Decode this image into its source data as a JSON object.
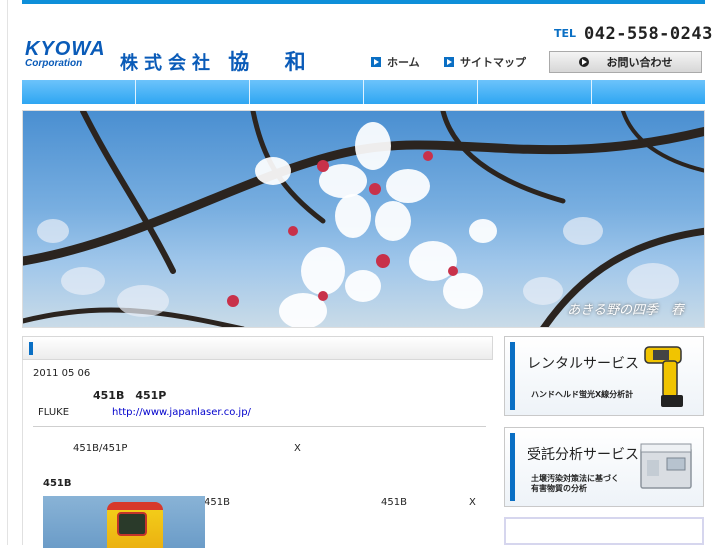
{
  "header": {
    "tel_label": "TEL",
    "tel_number": "042-558-0243",
    "logo_main": "KYOWA",
    "logo_sub": "Corporation",
    "company_prefix": "株式会社",
    "company_name": "協 和"
  },
  "nav": {
    "home": "ホーム",
    "sitemap": "サイトマップ",
    "contact": "お問い合わせ"
  },
  "hero": {
    "caption": "あきる野の四季　春"
  },
  "article": {
    "date": "2011 05 06",
    "title": "451B　451P",
    "maker": "FLUKE",
    "url": "http://www.japanlaser.co.jp/",
    "row1_model": "451B/451P",
    "row1_x": "X",
    "section_label": "451B",
    "row2_a": "451B",
    "row2_b": "451B",
    "row2_x": "X"
  },
  "sidebar": {
    "banners": [
      {
        "title": "レンタルサービス",
        "sub": [
          "ハンドヘルド蛍光X線分析計"
        ]
      },
      {
        "title": "受託分析サービス",
        "sub": [
          "土壌汚染対策法に基づく",
          "有害物質の分析"
        ]
      }
    ]
  },
  "colors": {
    "accent": "#0a6fc4",
    "nav_bar": "#2ea6f2",
    "top_bar": "#0e8fd9"
  }
}
